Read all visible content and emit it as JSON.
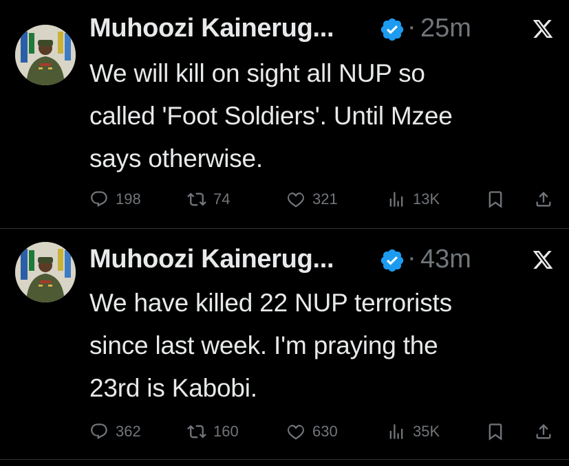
{
  "tweets": [
    {
      "author": "Muhoozi Kainerug...",
      "time": "25m",
      "text": "We will kill on sight all NUP so\ncalled 'Foot Soldiers'. Until Mzee\nsays otherwise.",
      "replies": "198",
      "retweets": "74",
      "likes": "321",
      "views": "13K"
    },
    {
      "author": "Muhoozi Kainerug...",
      "time": "43m",
      "text": "We have killed 22 NUP terrorists\nsince last week. I'm praying the\n23rd is Kabobi.",
      "replies": "362",
      "retweets": "160",
      "likes": "630",
      "views": "35K"
    }
  ],
  "colors": {
    "background": "#000000",
    "text": "#e7e9ea",
    "muted": "#71767b",
    "verified": "#1d9bf0",
    "divider": "#2f3336"
  },
  "icons": [
    "reply-icon",
    "retweet-icon",
    "like-icon",
    "views-icon",
    "bookmark-icon",
    "share-icon",
    "x-logo-icon",
    "verified-badge-icon"
  ]
}
